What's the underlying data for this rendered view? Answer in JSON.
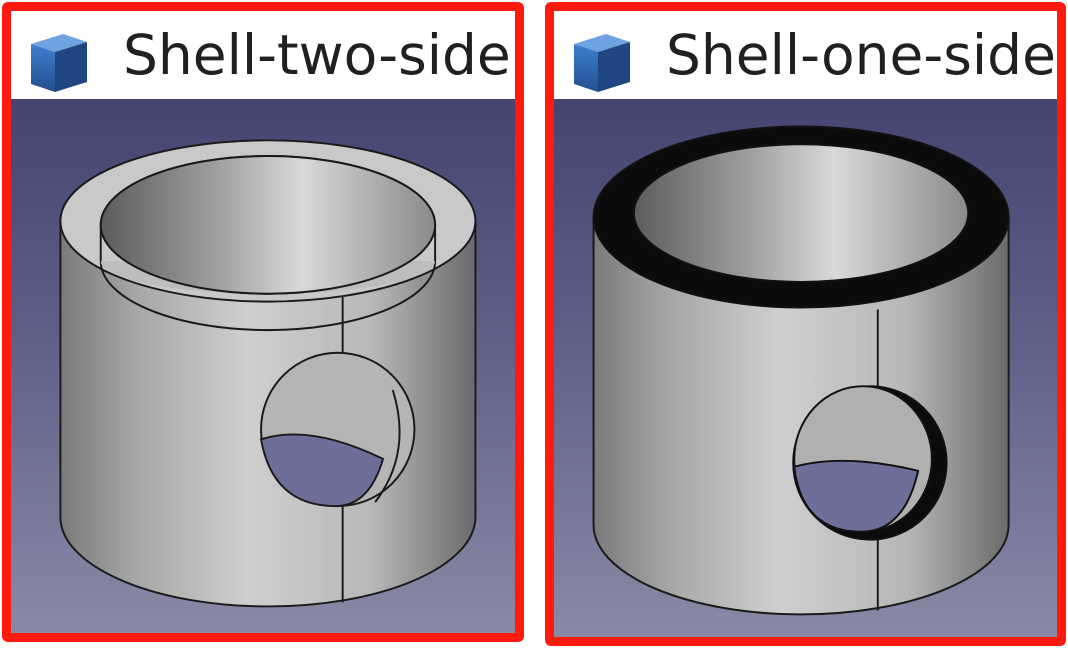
{
  "panels": [
    {
      "title": "Shell-two-side",
      "icon": "part-cube-icon"
    },
    {
      "title": "Shell-one-side",
      "icon": "part-cube-icon"
    }
  ],
  "colors": {
    "frame": "#ff1a0e",
    "viewport_top": "#434570",
    "viewport_bottom": "#8a8aa6",
    "cube": "#2f6cb7"
  }
}
